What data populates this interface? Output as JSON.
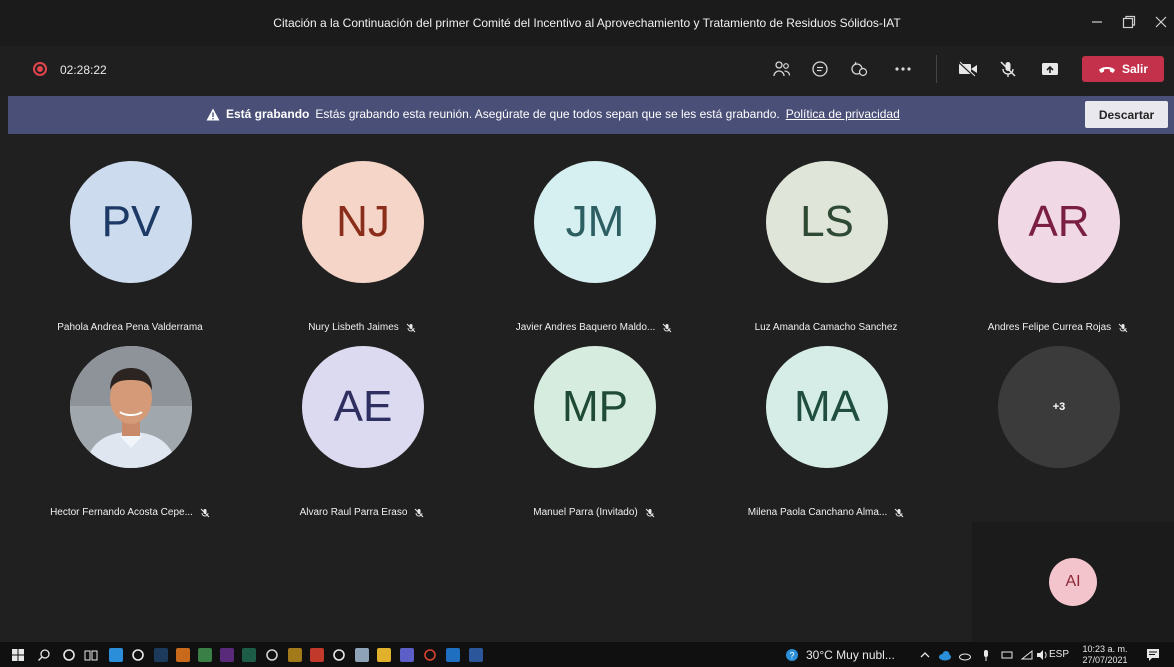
{
  "window": {
    "title": "Citación a la Continuación del primer Comité del Incentivo al Aprovechamiento y Tratamiento de Residuos Sólidos-IAT"
  },
  "toolbar": {
    "timer": "02:28:22",
    "icons": [
      "people-icon",
      "chat-icon",
      "reactions-icon",
      "more-icon",
      "camera-off-icon",
      "mic-off-icon",
      "share-icon"
    ],
    "leave_label": "Salir",
    "leave_color": "#c4314b"
  },
  "banner": {
    "strong": "Está grabando",
    "message": "Estás grabando esta reunión. Asegúrate de que todos sepan que se les está grabando.",
    "link": "Política de privacidad",
    "dismiss_label": "Descartar",
    "background": "#4a4f77"
  },
  "participants": [
    {
      "initials": "PV",
      "name": "Pahola Andrea Pena Valderrama",
      "muted": false,
      "bg": "#cddbef",
      "fg": "#1d3a66"
    },
    {
      "initials": "NJ",
      "name": "Nury Lisbeth Jaimes",
      "muted": true,
      "bg": "#f5d5c7",
      "fg": "#8a2d1a"
    },
    {
      "initials": "JM",
      "name": "Javier Andres Baquero Maldo...",
      "muted": true,
      "bg": "#d6f0f1",
      "fg": "#2d5f62"
    },
    {
      "initials": "LS",
      "name": "Luz Amanda Camacho Sanchez",
      "muted": false,
      "bg": "#dfe5d8",
      "fg": "#2f4a34"
    },
    {
      "initials": "AR",
      "name": "Andres Felipe Currea Rojas",
      "muted": true,
      "bg": "#f0d8e4",
      "fg": "#7a1f43"
    },
    {
      "initials": "",
      "name": "Hector Fernando Acosta Cepe...",
      "muted": true,
      "photo": true
    },
    {
      "initials": "AE",
      "name": "Alvaro Raul Parra Eraso",
      "muted": true,
      "bg": "#dcdaf0",
      "fg": "#2e2f60"
    },
    {
      "initials": "MP",
      "name": "Manuel Parra (Invitado)",
      "muted": true,
      "bg": "#d6ecdf",
      "fg": "#1f4b35"
    },
    {
      "initials": "MA",
      "name": "Milena Paola Canchano Alma...",
      "muted": true,
      "bg": "#d5ede6",
      "fg": "#1f4e3f"
    },
    {
      "initials": "+3",
      "name": "",
      "muted": false,
      "bg": "#3b3b3b",
      "fg": "#ffffff"
    }
  ],
  "self": {
    "initials": "AI"
  },
  "taskbar": {
    "weather": "30°C  Muy nubl...",
    "language": "ESP",
    "time": "10:23 a. m.",
    "date": "27/07/2021"
  }
}
